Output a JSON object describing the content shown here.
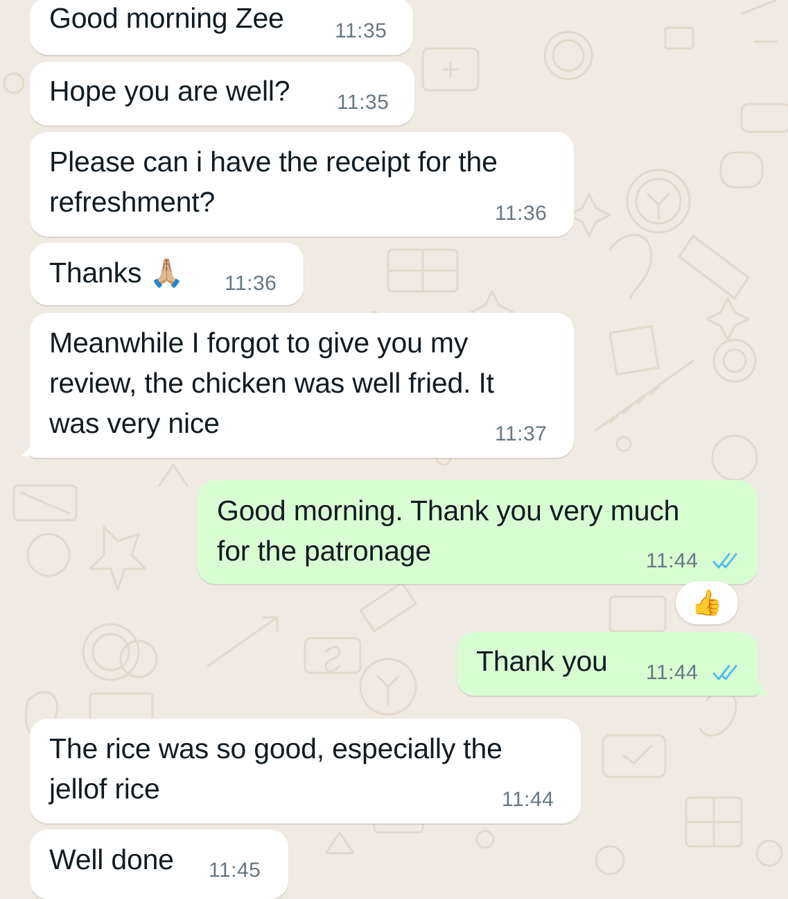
{
  "messages": [
    {
      "id": "m1",
      "direction": "incoming",
      "text": "Good morning Zee",
      "time": "11:35"
    },
    {
      "id": "m2",
      "direction": "incoming",
      "text": "Hope you are well?",
      "time": "11:35"
    },
    {
      "id": "m3",
      "direction": "incoming",
      "text": "Please can i have the receipt for the\nrefreshment?",
      "time": "11:36"
    },
    {
      "id": "m4",
      "direction": "incoming",
      "text": "Thanks",
      "emoji": "🙏🏼",
      "time": "11:36"
    },
    {
      "id": "m5",
      "direction": "incoming",
      "text": "Meanwhile I forgot to give you my\nreview, the chicken was well fried. It\nwas very nice",
      "time": "11:37"
    },
    {
      "id": "m6",
      "direction": "outgoing",
      "text": "Good morning. Thank you very much\nfor the patronage",
      "time": "11:44",
      "status": "read",
      "reaction": "👍"
    },
    {
      "id": "m7",
      "direction": "outgoing",
      "text": "Thank you",
      "time": "11:44",
      "status": "read"
    },
    {
      "id": "m8",
      "direction": "incoming",
      "text": "The rice was so good, especially the\njellof rice",
      "time": "11:44"
    },
    {
      "id": "m9",
      "direction": "incoming",
      "text": "Well done",
      "time": "11:45"
    }
  ],
  "colors": {
    "background": "#efeae2",
    "incoming_bubble": "#ffffff",
    "outgoing_bubble": "#d9fdd3",
    "read_ticks": "#53bdeb",
    "timestamp": "#667781"
  },
  "icons": {
    "read_receipt": "double-check-icon",
    "wallpaper": "doodle-pattern"
  }
}
